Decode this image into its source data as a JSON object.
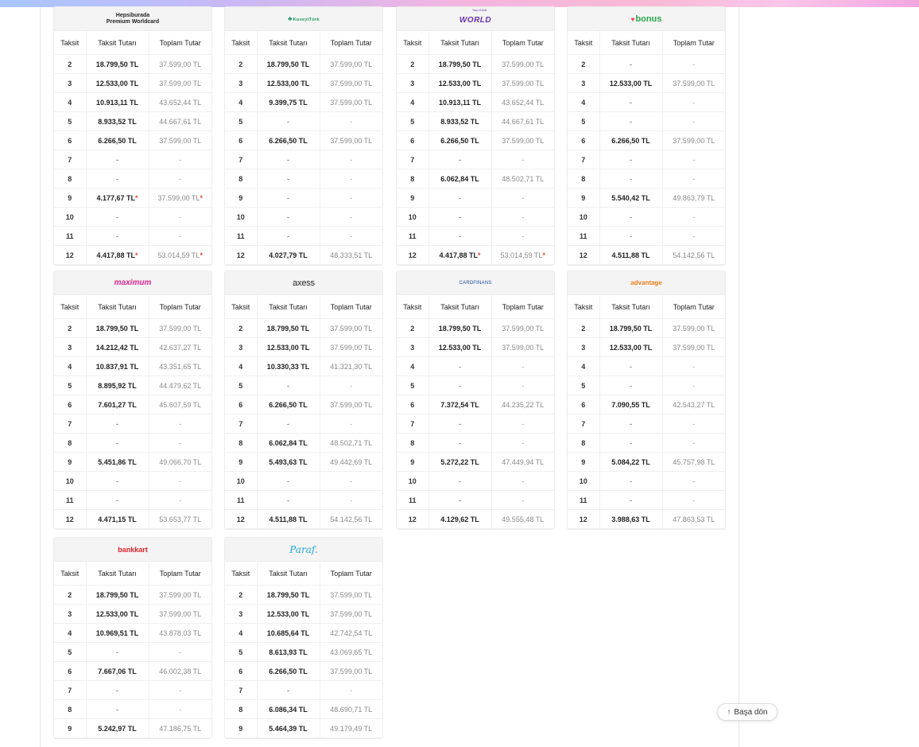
{
  "cards": [
    {
      "key": "hepsiburada",
      "logo": {
        "line1": "Hepsiburada",
        "line2": "Premium Worldcard"
      },
      "rows": [
        [
          "2",
          "18.799,50 TL",
          "37.599,00 TL"
        ],
        [
          "3",
          "12.533,00 TL",
          "37.599,00 TL"
        ],
        [
          "4",
          "10.913,11 TL",
          "43.652,44 TL"
        ],
        [
          "5",
          "8.933,52 TL",
          "44.667,61 TL"
        ],
        [
          "6",
          "6.266,50 TL",
          "37.599,00 TL"
        ],
        [
          "7",
          "-",
          "-"
        ],
        [
          "8",
          "-",
          "-"
        ],
        [
          "9",
          "4.177,67 TL",
          "37.599,00 TL"
        ],
        [
          "10",
          "-",
          "-"
        ],
        [
          "11",
          "-",
          "-"
        ],
        [
          "12",
          "4.417,88 TL",
          "53.014,59 TL"
        ]
      ],
      "starred_rows": [
        7,
        10
      ]
    },
    {
      "key": "kuveytturk",
      "logo": {
        "text": "KuveytTürk"
      },
      "rows": [
        [
          "2",
          "18.799,50 TL",
          "37.599,00 TL"
        ],
        [
          "3",
          "12.533,00 TL",
          "37.599,00 TL"
        ],
        [
          "4",
          "9.399,75 TL",
          "37.599,00 TL"
        ],
        [
          "5",
          "-",
          "-"
        ],
        [
          "6",
          "6.266,50 TL",
          "37.599,00 TL"
        ],
        [
          "7",
          "-",
          "-"
        ],
        [
          "8",
          "-",
          "-"
        ],
        [
          "9",
          "-",
          "-"
        ],
        [
          "10",
          "-",
          "-"
        ],
        [
          "11",
          "-",
          "-"
        ],
        [
          "12",
          "4.027,79 TL",
          "48.333,51 TL"
        ]
      ],
      "starred_rows": []
    },
    {
      "key": "world",
      "logo": {
        "small": "Yapı Kredi",
        "text": "WORLD"
      },
      "rows": [
        [
          "2",
          "18.799,50 TL",
          "37.599,00 TL"
        ],
        [
          "3",
          "12.533,00 TL",
          "37.599,00 TL"
        ],
        [
          "4",
          "10.913,11 TL",
          "43.652,44 TL"
        ],
        [
          "5",
          "8.933,52 TL",
          "44.667,61 TL"
        ],
        [
          "6",
          "6.266,50 TL",
          "37.599,00 TL"
        ],
        [
          "7",
          "-",
          "-"
        ],
        [
          "8",
          "6.062,84 TL",
          "48.502,71 TL"
        ],
        [
          "9",
          "-",
          "-"
        ],
        [
          "10",
          "-",
          "-"
        ],
        [
          "11",
          "-",
          "-"
        ],
        [
          "12",
          "4.417,88 TL",
          "53.014,59 TL"
        ]
      ],
      "starred_rows": [
        10
      ]
    },
    {
      "key": "bonus",
      "logo": {
        "text": "bonus"
      },
      "rows": [
        [
          "2",
          "-",
          "-"
        ],
        [
          "3",
          "12.533,00 TL",
          "37.599,00 TL"
        ],
        [
          "4",
          "-",
          "-"
        ],
        [
          "5",
          "-",
          "-"
        ],
        [
          "6",
          "6.266,50 TL",
          "37.599,00 TL"
        ],
        [
          "7",
          "-",
          "-"
        ],
        [
          "8",
          "-",
          "-"
        ],
        [
          "9",
          "5.540,42 TL",
          "49.863,79 TL"
        ],
        [
          "10",
          "-",
          "-"
        ],
        [
          "11",
          "-",
          "-"
        ],
        [
          "12",
          "4.511,88 TL",
          "54.142,56 TL"
        ]
      ],
      "starred_rows": []
    },
    {
      "key": "maximum",
      "logo": {
        "text": "maximum"
      },
      "rows": [
        [
          "2",
          "18.799,50 TL",
          "37.599,00 TL"
        ],
        [
          "3",
          "14.212,42 TL",
          "42.637,27 TL"
        ],
        [
          "4",
          "10.837,91 TL",
          "43.351,65 TL"
        ],
        [
          "5",
          "8.895,92 TL",
          "44.479,62 TL"
        ],
        [
          "6",
          "7.601,27 TL",
          "45.607,59 TL"
        ],
        [
          "7",
          "-",
          "-"
        ],
        [
          "8",
          "-",
          "-"
        ],
        [
          "9",
          "5.451,86 TL",
          "49.066,70 TL"
        ],
        [
          "10",
          "-",
          "-"
        ],
        [
          "11",
          "-",
          "-"
        ],
        [
          "12",
          "4.471,15 TL",
          "53.653,77 TL"
        ]
      ],
      "starred_rows": []
    },
    {
      "key": "axess",
      "logo": {
        "text": "axess"
      },
      "rows": [
        [
          "2",
          "18.799,50 TL",
          "37.599,00 TL"
        ],
        [
          "3",
          "12.533,00 TL",
          "37.599,00 TL"
        ],
        [
          "4",
          "10.330,33 TL",
          "41.321,30 TL"
        ],
        [
          "5",
          "-",
          "-"
        ],
        [
          "6",
          "6.266,50 TL",
          "37.599,00 TL"
        ],
        [
          "7",
          "-",
          "-"
        ],
        [
          "8",
          "6.062,84 TL",
          "48.502,71 TL"
        ],
        [
          "9",
          "5.493,63 TL",
          "49.442,69 TL"
        ],
        [
          "10",
          "-",
          "-"
        ],
        [
          "11",
          "-",
          "-"
        ],
        [
          "12",
          "4.511,88 TL",
          "54.142,56 TL"
        ]
      ],
      "starred_rows": []
    },
    {
      "key": "cardfinans",
      "logo": {
        "text": "CARDFINANS"
      },
      "rows": [
        [
          "2",
          "18.799,50 TL",
          "37.599,00 TL"
        ],
        [
          "3",
          "12.533,00 TL",
          "37.599,00 TL"
        ],
        [
          "4",
          "-",
          "-"
        ],
        [
          "5",
          "-",
          "-"
        ],
        [
          "6",
          "7.372,54 TL",
          "44.235,22 TL"
        ],
        [
          "7",
          "-",
          "-"
        ],
        [
          "8",
          "-",
          "-"
        ],
        [
          "9",
          "5.272,22 TL",
          "47.449,94 TL"
        ],
        [
          "10",
          "-",
          "-"
        ],
        [
          "11",
          "-",
          "-"
        ],
        [
          "12",
          "4.129,62 TL",
          "49.555,48 TL"
        ]
      ],
      "starred_rows": []
    },
    {
      "key": "advantage",
      "logo": {
        "text": "advantage"
      },
      "rows": [
        [
          "2",
          "18.799,50 TL",
          "37.599,00 TL"
        ],
        [
          "3",
          "12.533,00 TL",
          "37.599,00 TL"
        ],
        [
          "4",
          "-",
          "-"
        ],
        [
          "5",
          "-",
          "-"
        ],
        [
          "6",
          "7.090,55 TL",
          "42.543,27 TL"
        ],
        [
          "7",
          "-",
          "-"
        ],
        [
          "8",
          "-",
          "-"
        ],
        [
          "9",
          "5.084,22 TL",
          "45.757,98 TL"
        ],
        [
          "10",
          "-",
          "-"
        ],
        [
          "11",
          "-",
          "-"
        ],
        [
          "12",
          "3.988,63 TL",
          "47.863,53 TL"
        ]
      ],
      "starred_rows": []
    },
    {
      "key": "bankkart",
      "logo": {
        "text": "bankkart"
      },
      "rows": [
        [
          "2",
          "18.799,50 TL",
          "37.599,00 TL"
        ],
        [
          "3",
          "12.533,00 TL",
          "37.599,00 TL"
        ],
        [
          "4",
          "10.969,51 TL",
          "43.878,03 TL"
        ],
        [
          "5",
          "-",
          "-"
        ],
        [
          "6",
          "7.667,06 TL",
          "46.002,38 TL"
        ],
        [
          "7",
          "-",
          "-"
        ],
        [
          "8",
          "-",
          "-"
        ],
        [
          "9",
          "5.242,97 TL",
          "47.186,75 TL"
        ]
      ],
      "starred_rows": []
    },
    {
      "key": "paraf",
      "logo": {
        "text": "Paraf."
      },
      "rows": [
        [
          "2",
          "18.799,50 TL",
          "37.599,00 TL"
        ],
        [
          "3",
          "12.533,00 TL",
          "37.599,00 TL"
        ],
        [
          "4",
          "10.685,64 TL",
          "42.742,54 TL"
        ],
        [
          "5",
          "8.613,93 TL",
          "43.069,65 TL"
        ],
        [
          "6",
          "6.266,50 TL",
          "37.599,00 TL"
        ],
        [
          "7",
          "-",
          "-"
        ],
        [
          "8",
          "6.086,34 TL",
          "48.690,71 TL"
        ],
        [
          "9",
          "5.464,39 TL",
          "49.179,49 TL"
        ]
      ],
      "starred_rows": []
    }
  ],
  "table_headers": {
    "col1": "Taksit",
    "col2": "Taksit Tutarı",
    "col3": "Toplam Tutar"
  },
  "star_mark": "*",
  "back_to_top": {
    "label": "Başa dön",
    "icon": "arrow-up-icon"
  },
  "colors": {
    "star": "#e74c3c",
    "header_bg": "#f4f4f4"
  }
}
